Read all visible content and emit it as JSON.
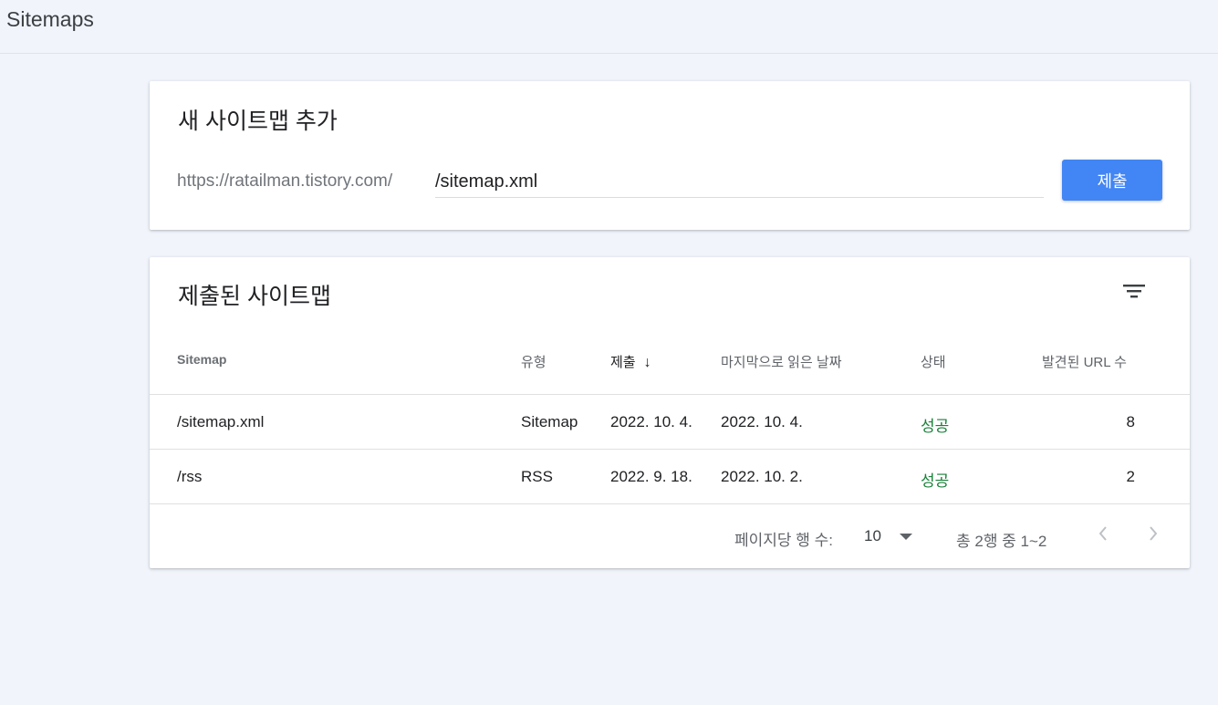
{
  "header": {
    "title": "Sitemaps"
  },
  "add_card": {
    "title": "새 사이트맵 추가",
    "url_prefix": "https://ratailman.tistory.com/",
    "input_value": "/sitemap.xml",
    "submit_label": "제출"
  },
  "list_card": {
    "title": "제출된 사이트맵",
    "filter_icon": "filter-icon",
    "columns": {
      "sitemap": "Sitemap",
      "type": "유형",
      "submitted": "제출",
      "submitted_sort": "↓",
      "last_read": "마지막으로 읽은 날짜",
      "status": "상태",
      "urls": "발견된 URL 수"
    },
    "rows": [
      {
        "sitemap": "/sitemap.xml",
        "type": "Sitemap",
        "submitted": "2022. 10. 4.",
        "last_read": "2022. 10. 4.",
        "status": "성공",
        "urls": "8"
      },
      {
        "sitemap": "/rss",
        "type": "RSS",
        "submitted": "2022. 9. 18.",
        "last_read": "2022. 10. 2.",
        "status": "성공",
        "urls": "2"
      }
    ],
    "pagination": {
      "rows_per_page_label": "페이지당 행 수:",
      "rows_per_page_value": "10",
      "range_text": "총 2행 중 1~2"
    }
  },
  "colors": {
    "accent": "#4285f4",
    "success": "#188038",
    "background": "#f1f4fb"
  }
}
